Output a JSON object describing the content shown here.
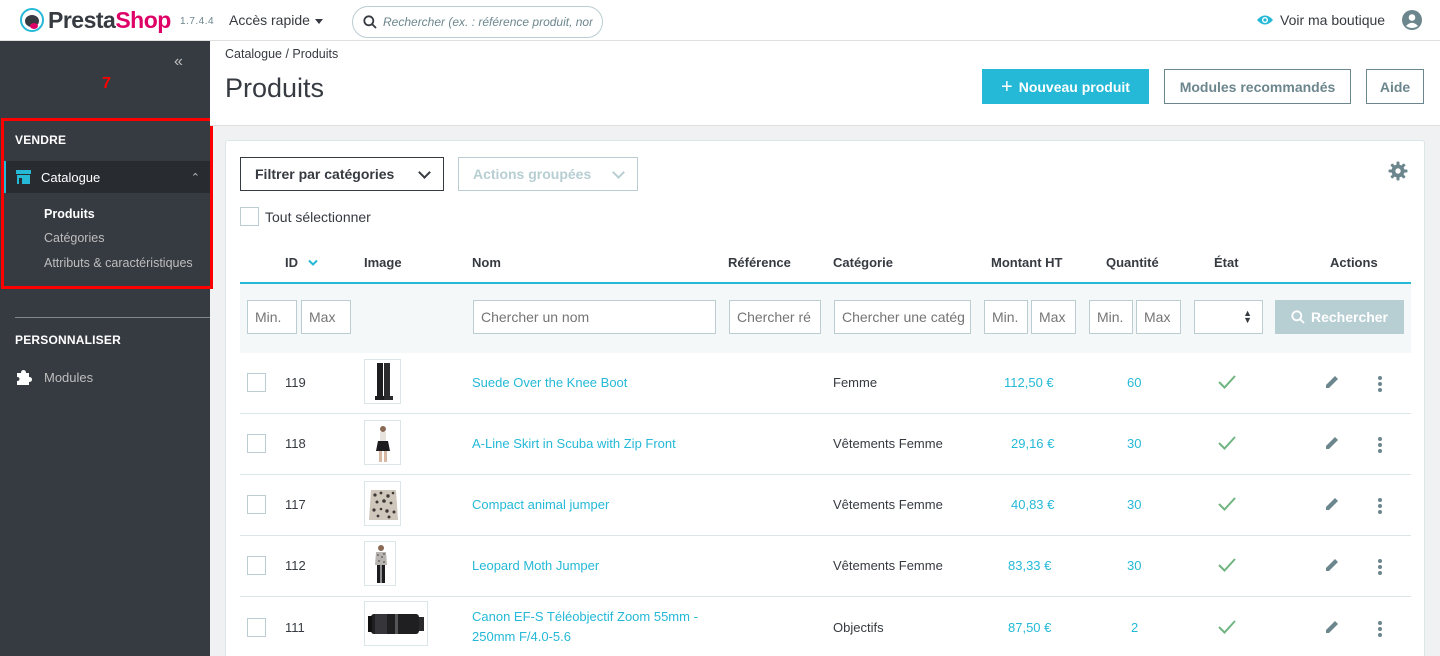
{
  "brand": {
    "name_part1": "Presta",
    "name_part2": "Shop",
    "version": "1.7.4.4"
  },
  "topbar": {
    "quick_access": "Accès rapide",
    "search_placeholder": "Rechercher (ex. : référence produit, nom",
    "view_shop": "Voir ma boutique"
  },
  "sidebar": {
    "marker": "7",
    "sell_heading": "VENDRE",
    "catalog_label": "Catalogue",
    "sub_items": [
      "Produits",
      "Catégories",
      "Attributs & caractéristiques"
    ],
    "customize_heading": "PERSONNALISER",
    "modules_label": "Modules"
  },
  "header": {
    "breadcrumb": "Catalogue  /  Produits",
    "title": "Produits",
    "new_product": "Nouveau produit",
    "recommended_modules": "Modules recommandés",
    "help": "Aide"
  },
  "toolbar": {
    "filter_categories": "Filtrer par catégories",
    "bulk_actions": "Actions groupées",
    "select_all": "Tout sélectionner"
  },
  "columns": {
    "id": "ID",
    "image": "Image",
    "name": "Nom",
    "reference": "Référence",
    "category": "Catégorie",
    "price": "Montant HT",
    "quantity": "Quantité",
    "status": "État",
    "actions": "Actions"
  },
  "filters": {
    "id_min": "Min.",
    "id_max": "Max",
    "name": "Chercher un nom",
    "reference": "Chercher ré",
    "category": "Chercher une catég",
    "price_min": "Min.",
    "price_max": "Max",
    "qty_min": "Min.",
    "qty_max": "Max",
    "search_button": "Rechercher"
  },
  "products": [
    {
      "id": "119",
      "name": "Suede Over the Knee Boot",
      "name2": "",
      "category": "Femme",
      "price": "112,50 €",
      "quantity": "60",
      "active": true
    },
    {
      "id": "118",
      "name": "A-Line Skirt in Scuba with Zip Front",
      "name2": "",
      "category": "Vêtements Femme",
      "price": "29,16 €",
      "quantity": "30",
      "active": true
    },
    {
      "id": "117",
      "name": "Compact animal jumper",
      "name2": "",
      "category": "Vêtements Femme",
      "price": "40,83 €",
      "quantity": "30",
      "active": true
    },
    {
      "id": "112",
      "name": "Leopard Moth Jumper",
      "name2": "",
      "category": "Vêtements Femme",
      "price": "83,33 €",
      "quantity": "30",
      "active": true
    },
    {
      "id": "111",
      "name": "Canon EF-S Téléobjectif Zoom 55mm -",
      "name2": "250mm F/4.0-5.6",
      "category": "Objectifs",
      "price": "87,50 €",
      "quantity": "2",
      "active": true
    }
  ],
  "colors": {
    "accent": "#25b9d7",
    "sidebar": "#363a41",
    "success": "#70b580",
    "brand_pink": "#df0067",
    "highlight": "#ff0000"
  }
}
